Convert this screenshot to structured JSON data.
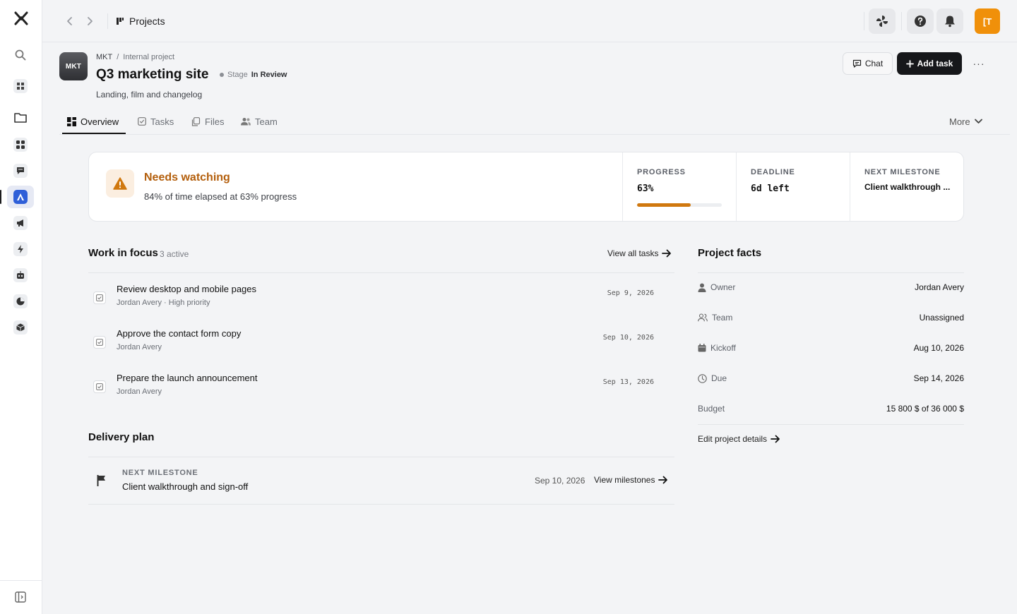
{
  "topbar": {
    "breadcrumb": "Projects",
    "avatar_initials": "[T"
  },
  "sidebar": {
    "items": [
      {
        "name": "search-icon"
      },
      {
        "name": "dashboard-icon"
      },
      {
        "name": "folder-icon"
      },
      {
        "name": "apps-icon"
      },
      {
        "name": "chat-icon"
      },
      {
        "name": "projects-icon",
        "active": true
      },
      {
        "name": "megaphone-icon"
      },
      {
        "name": "bolt-icon"
      },
      {
        "name": "bot-icon"
      },
      {
        "name": "pie-chart-icon"
      },
      {
        "name": "cube-icon"
      }
    ]
  },
  "project": {
    "icon_code": "MKT",
    "code": "MKT",
    "separator": "/",
    "type": "Internal project",
    "title": "Q3 marketing site",
    "stage_label": "Stage",
    "stage_value": "In Review",
    "description": "Landing, film and changelog",
    "chat_label": "Chat",
    "add_task_label": "Add task",
    "more_dots": "···"
  },
  "tabs": [
    {
      "label": "Overview",
      "active": true
    },
    {
      "label": "Tasks"
    },
    {
      "label": "Files"
    },
    {
      "label": "Team"
    }
  ],
  "more_tab_label": "More",
  "status": {
    "title": "Needs watching",
    "subtitle": "84% of time elapsed at 63% progress",
    "progress_label": "PROGRESS",
    "progress_value": "63%",
    "progress_fraction": 0.63,
    "deadline_label": "DEADLINE",
    "deadline_value": "6d left",
    "milestone_label": "NEXT MILESTONE",
    "milestone_value": "Client walkthrough ...",
    "accent_color": "#d0780f"
  },
  "work": {
    "title": "Work in focus",
    "count": "3 active",
    "view_all": "View all tasks",
    "tasks": [
      {
        "title": "Review desktop and mobile pages",
        "meta": "Jordan Avery · High priority",
        "date": "Sep 9, 2026"
      },
      {
        "title": "Approve the contact form copy",
        "meta": "Jordan Avery",
        "date": "Sep 10, 2026"
      },
      {
        "title": "Prepare the launch announcement",
        "meta": "Jordan Avery",
        "date": "Sep 13, 2026"
      }
    ]
  },
  "delivery": {
    "title": "Delivery plan",
    "milestone_label": "NEXT MILESTONE",
    "milestone_name": "Client walkthrough and sign-off",
    "milestone_date": "Sep 10, 2026",
    "view_link": "View milestones"
  },
  "facts": {
    "title": "Project facts",
    "owner_label": "Owner",
    "owner_value": "Jordan Avery",
    "team_label": "Team",
    "team_value": "Unassigned",
    "kickoff_label": "Kickoff",
    "kickoff_value": "Aug 10, 2026",
    "due_label": "Due",
    "due_value": "Sep 14, 2026",
    "budget_label": "Budget",
    "budget_value": "15 800 $ of 36 000 $",
    "edit_link": "Edit project details"
  }
}
